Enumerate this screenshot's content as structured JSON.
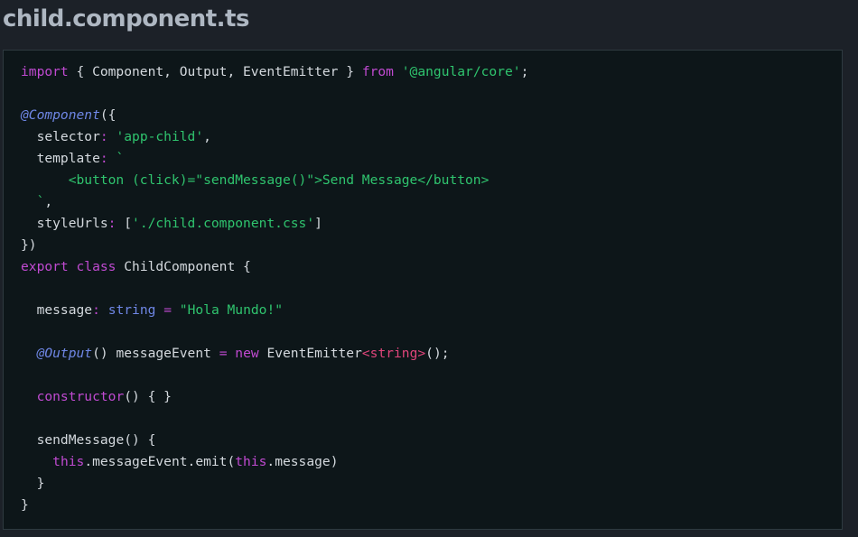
{
  "header": {
    "filename": "child.component.ts"
  },
  "code": {
    "language": "typescript",
    "lines": [
      [
        {
          "t": "kw",
          "v": "import"
        },
        {
          "t": "punc",
          "v": " { Component, Output, EventEmitter } "
        },
        {
          "t": "kw",
          "v": "from"
        },
        {
          "t": "punc",
          "v": " "
        },
        {
          "t": "str",
          "v": "'@angular/core'"
        },
        {
          "t": "punc",
          "v": ";"
        }
      ],
      [],
      [
        {
          "t": "deco",
          "v": "@Component"
        },
        {
          "t": "punc",
          "v": "({"
        }
      ],
      [
        {
          "t": "ws",
          "v": "  "
        },
        {
          "t": "prop",
          "v": "selector"
        },
        {
          "t": "op",
          "v": ":"
        },
        {
          "t": "punc",
          "v": " "
        },
        {
          "t": "str",
          "v": "'app-child'"
        },
        {
          "t": "punc",
          "v": ","
        }
      ],
      [
        {
          "t": "ws",
          "v": "  "
        },
        {
          "t": "prop",
          "v": "template"
        },
        {
          "t": "op",
          "v": ":"
        },
        {
          "t": "punc",
          "v": " "
        },
        {
          "t": "str",
          "v": "`"
        }
      ],
      [
        {
          "t": "str",
          "v": "      <button (click)=\"sendMessage()\">Send Message</button>"
        }
      ],
      [
        {
          "t": "str",
          "v": "  `"
        },
        {
          "t": "punc",
          "v": ","
        }
      ],
      [
        {
          "t": "ws",
          "v": "  "
        },
        {
          "t": "prop",
          "v": "styleUrls"
        },
        {
          "t": "op",
          "v": ":"
        },
        {
          "t": "punc",
          "v": " ["
        },
        {
          "t": "str",
          "v": "'./child.component.css'"
        },
        {
          "t": "punc",
          "v": "]"
        }
      ],
      [
        {
          "t": "punc",
          "v": "})"
        }
      ],
      [
        {
          "t": "kw",
          "v": "export"
        },
        {
          "t": "punc",
          "v": " "
        },
        {
          "t": "kw",
          "v": "class"
        },
        {
          "t": "punc",
          "v": " "
        },
        {
          "t": "id",
          "v": "ChildComponent"
        },
        {
          "t": "punc",
          "v": " {"
        }
      ],
      [],
      [
        {
          "t": "ws",
          "v": "  "
        },
        {
          "t": "prop",
          "v": "message"
        },
        {
          "t": "op",
          "v": ":"
        },
        {
          "t": "punc",
          "v": " "
        },
        {
          "t": "type",
          "v": "string"
        },
        {
          "t": "punc",
          "v": " "
        },
        {
          "t": "op",
          "v": "="
        },
        {
          "t": "punc",
          "v": " "
        },
        {
          "t": "str",
          "v": "\"Hola Mundo!\""
        }
      ],
      [],
      [
        {
          "t": "ws",
          "v": "  "
        },
        {
          "t": "deco",
          "v": "@Output"
        },
        {
          "t": "punc",
          "v": "() messageEvent "
        },
        {
          "t": "op",
          "v": "="
        },
        {
          "t": "punc",
          "v": " "
        },
        {
          "t": "kw",
          "v": "new"
        },
        {
          "t": "punc",
          "v": " "
        },
        {
          "t": "id",
          "v": "EventEmitter"
        },
        {
          "t": "gen",
          "v": "<string>"
        },
        {
          "t": "punc",
          "v": "();"
        }
      ],
      [],
      [
        {
          "t": "ws",
          "v": "  "
        },
        {
          "t": "kw",
          "v": "constructor"
        },
        {
          "t": "punc",
          "v": "() { }"
        }
      ],
      [],
      [
        {
          "t": "ws",
          "v": "  "
        },
        {
          "t": "id",
          "v": "sendMessage"
        },
        {
          "t": "punc",
          "v": "() {"
        }
      ],
      [
        {
          "t": "ws",
          "v": "    "
        },
        {
          "t": "kw",
          "v": "this"
        },
        {
          "t": "punc",
          "v": ".messageEvent.emit("
        },
        {
          "t": "kw",
          "v": "this"
        },
        {
          "t": "punc",
          "v": ".message)"
        }
      ],
      [
        {
          "t": "punc",
          "v": "  }"
        }
      ],
      [
        {
          "t": "punc",
          "v": "}"
        }
      ]
    ]
  },
  "colors": {
    "page_background": "#1c2128",
    "code_background": "#0d1619",
    "keyword": "#c04ad1",
    "string": "#2fc46e",
    "decorator": "#6f87e6",
    "type": "#6f87e6",
    "generic": "#e0457b",
    "text": "#d4d9de",
    "title": "#aeb7c2"
  }
}
